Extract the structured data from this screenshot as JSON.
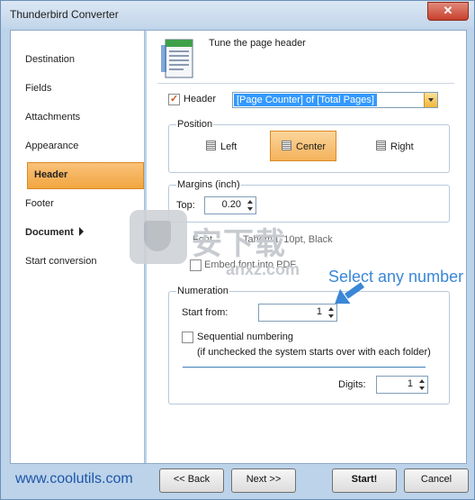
{
  "window": {
    "title": "Thunderbird Converter",
    "close_glyph": "✕"
  },
  "sidebar": {
    "items": [
      {
        "label": "Destination"
      },
      {
        "label": "Fields"
      },
      {
        "label": "Attachments"
      },
      {
        "label": "Appearance"
      },
      {
        "label": "Header"
      },
      {
        "label": "Footer"
      },
      {
        "label": "Document"
      },
      {
        "label": "Start conversion"
      }
    ],
    "active": "Header",
    "active_color": "#f4b25a"
  },
  "main": {
    "title": "Tune the page header",
    "header_checkbox": {
      "label": "Header",
      "checked": true
    },
    "header_combo": {
      "value": "[Page Counter] of [Total Pages]"
    },
    "position": {
      "label": "Position",
      "options": [
        {
          "label": "Left"
        },
        {
          "label": "Center"
        },
        {
          "label": "Right"
        }
      ],
      "selected": "Center"
    },
    "margins": {
      "label": "Margins (inch)",
      "top_label": "Top:",
      "top_value": "0.20"
    },
    "font": {
      "label": "Font",
      "value": "Tahoma, 10pt, Black"
    },
    "embed_font": {
      "label": "Embed font into PDF",
      "checked": false
    },
    "numeration": {
      "label": "Numeration",
      "start_label": "Start from:",
      "start_value": "1",
      "sequential_label": "Sequential numbering",
      "sequential_note": "(if unchecked the system starts over with each folder)",
      "sequential_checked": false,
      "digits_label": "Digits:",
      "digits_value": "1"
    }
  },
  "annotation": {
    "text": "Select any number",
    "color": "#3a87d6"
  },
  "watermark": {
    "text": "安下载",
    "url": "anxz.com"
  },
  "footer": {
    "url": "www.coolutils.com",
    "back": "<< Back",
    "next": "Next >>",
    "start": "Start!",
    "cancel": "Cancel"
  }
}
